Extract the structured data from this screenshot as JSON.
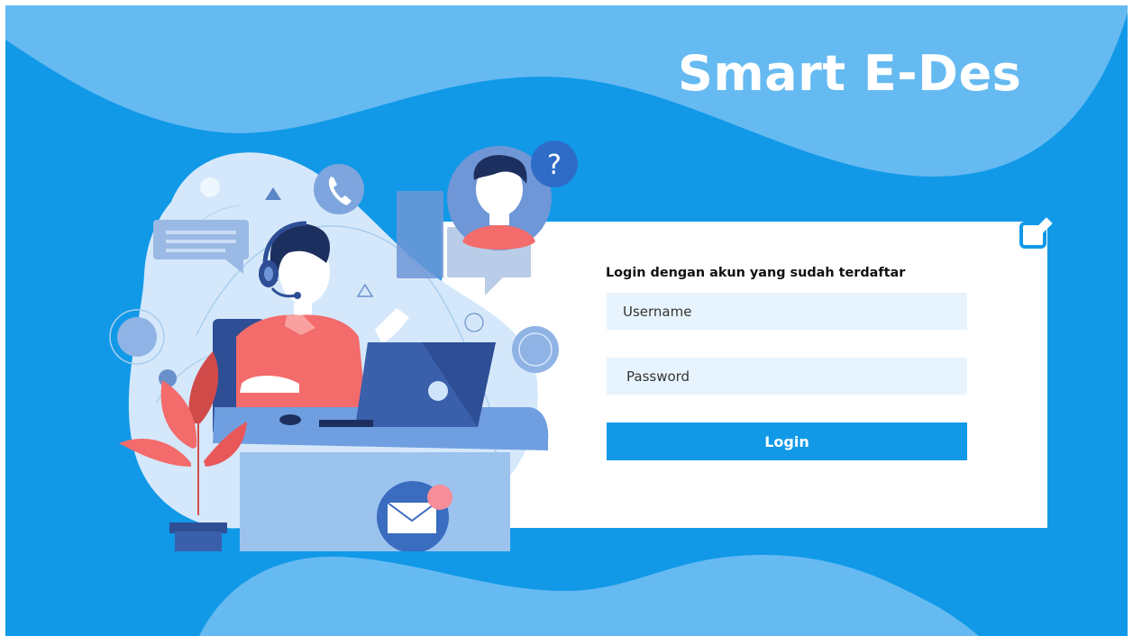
{
  "app": {
    "title": "Smart E-Des"
  },
  "login": {
    "heading": "Login dengan akun yang sudah terdaftar",
    "username": {
      "placeholder": "Username",
      "value": ""
    },
    "password": {
      "placeholder": "Password",
      "value": ""
    },
    "submit_label": "Login"
  },
  "icons": {
    "edit": "edit-icon",
    "phone": "phone-icon",
    "question": "question-icon",
    "mail": "mail-icon",
    "laptop": "laptop-icon",
    "headset": "headset-icon",
    "chat_bubble": "chat-bubble-icon",
    "plant": "plant-icon"
  },
  "colors": {
    "background": "#1199e8",
    "wave": "#66baf2",
    "card": "#ffffff",
    "input_background": "#e8f4fd",
    "button": "#1199e8",
    "button_text": "#ffffff",
    "title_text": "#ffffff",
    "heading_text": "#111111",
    "accent_red": "#f36b6b"
  }
}
